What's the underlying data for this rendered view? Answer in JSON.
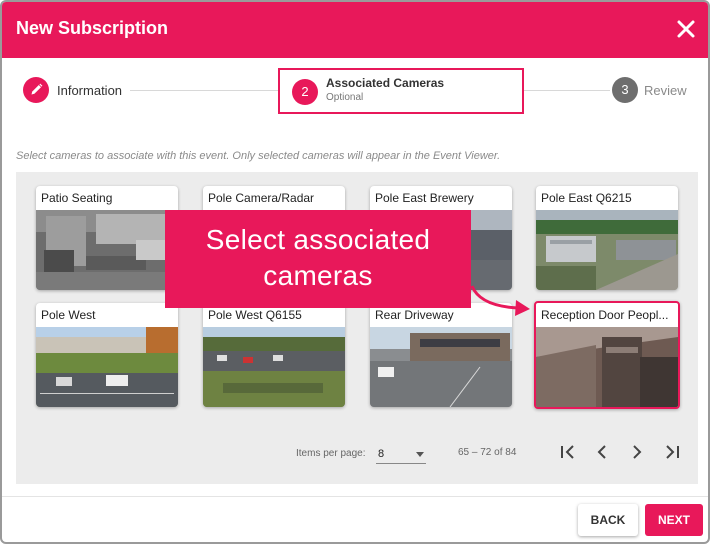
{
  "dialog": {
    "title": "New Subscription",
    "close_icon": "close-icon"
  },
  "colors": {
    "accent": "#e8185a",
    "inactive_step": "#6e6e6e",
    "panel_bg": "#ececec"
  },
  "stepper": {
    "steps": [
      {
        "icon": "pencil-icon",
        "label": "Information",
        "sub": ""
      },
      {
        "number": "2",
        "label": "Associated Cameras",
        "sub": "Optional"
      },
      {
        "number": "3",
        "label": "Review",
        "sub": ""
      }
    ]
  },
  "instructions": "Select cameras to associate with this event. Only selected cameras will appear in the Event Viewer.",
  "cameras": [
    {
      "name": "Patio Seating",
      "selected": false
    },
    {
      "name": "Pole Camera/Radar",
      "selected": false
    },
    {
      "name": "Pole East Brewery",
      "selected": false
    },
    {
      "name": "Pole East Q6215",
      "selected": false
    },
    {
      "name": "Pole West",
      "selected": false
    },
    {
      "name": "Pole West Q6155",
      "selected": false
    },
    {
      "name": "Rear Driveway",
      "selected": false
    },
    {
      "name": "Reception Door Peopl...",
      "selected": true
    }
  ],
  "pagination": {
    "items_per_page_label": "Items per page:",
    "items_per_page_value": "8",
    "range_text": "65 – 72 of 84"
  },
  "callout": {
    "line1": "Select associated",
    "line2": "cameras"
  },
  "buttons": {
    "back": "BACK",
    "next": "NEXT"
  }
}
